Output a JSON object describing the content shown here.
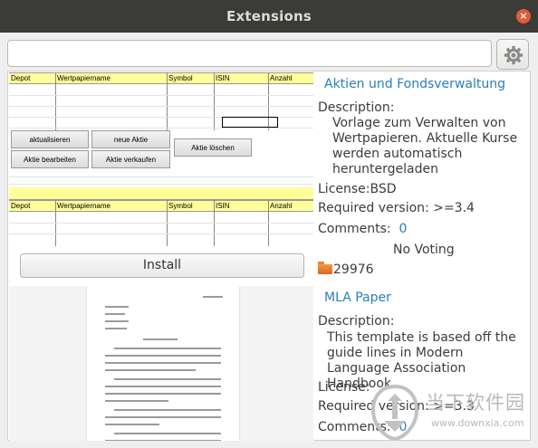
{
  "window": {
    "title": "Extensions",
    "close_glyph": "×"
  },
  "search": {
    "value": "",
    "placeholder": ""
  },
  "icons": {
    "settings": "gear-icon",
    "close": "close-icon",
    "download": "folder-icon",
    "watermark_logo": "downloadwa-logo"
  },
  "extensions": [
    {
      "title": "Aktien und Fondsverwaltung",
      "description_label": "Description:",
      "description": "Vorlage zum Verwalten von Wertpapieren. Aktuelle Kurse werden automatisch heruntergeladen",
      "license_label": "License:",
      "license": "BSD",
      "required_version_label": "Required version:",
      "required_version": ">=3.4",
      "comments_label": "Comments:",
      "comments": "0",
      "voting": "No Voting",
      "downloads": "29976",
      "install_label": "Install",
      "preview": {
        "headers": [
          "Depot",
          "Wertpapiername",
          "Symbol",
          "ISIN",
          "Anzahl"
        ],
        "buttons": [
          "aktualisieren",
          "neue Aktie",
          "Aktie löschen",
          "Aktie bearbeiten",
          "Aktie verkaufen"
        ]
      }
    },
    {
      "title": "MLA Paper",
      "description_label": "Description:",
      "description": "This template is based off the guide lines in Modern Language Association Handbook.",
      "license_label": "License:",
      "license": "",
      "required_version_label": "Required version:",
      "required_version": ">=3.3",
      "comments_label": "Comments:",
      "comments": "0"
    }
  ],
  "watermark": {
    "name": "当下软件园",
    "url": "www.downxia.com"
  },
  "colors": {
    "titlebar": "#3b3b37",
    "link": "#2a7fb8",
    "close": "#e25c37",
    "sheet_header": "#ffff99"
  }
}
